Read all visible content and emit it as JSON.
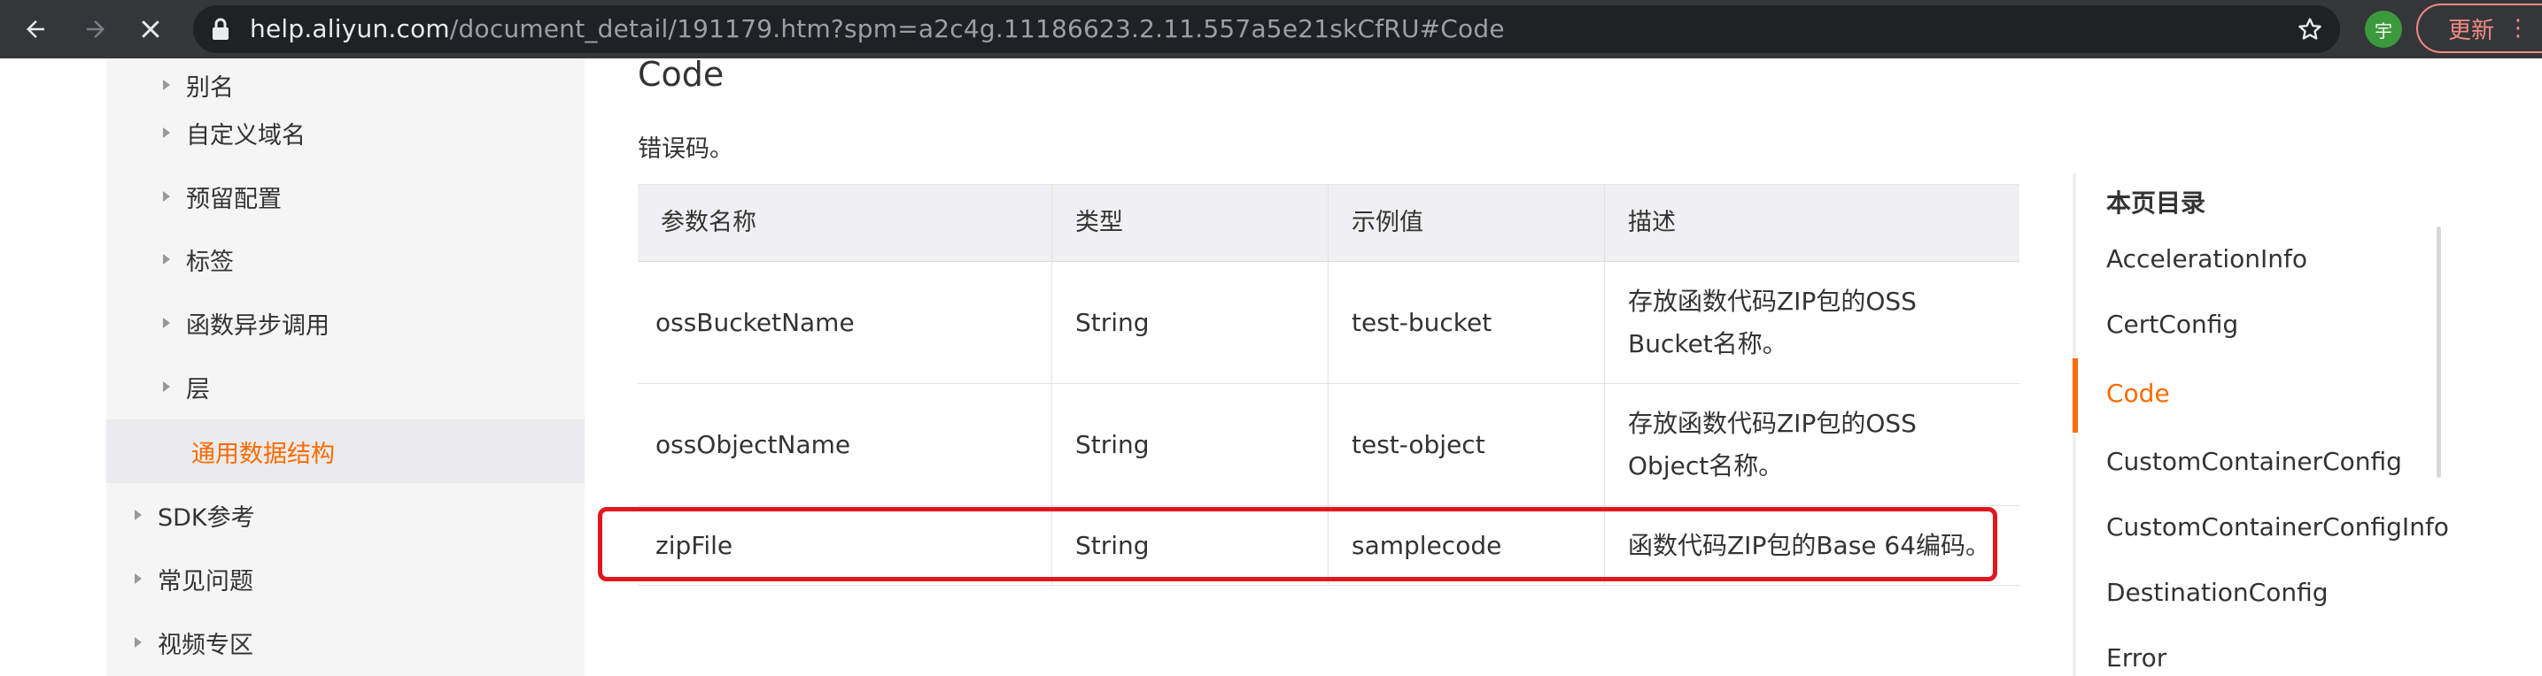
{
  "browser": {
    "url_host": "help.aliyun.com",
    "url_path": "/document_detail/191179.htm?spm=a2c4g.11186623.2.11.557a5e21skCfRU#Code",
    "profile_initial": "宇",
    "update_label": "更新"
  },
  "sidebar": {
    "items": [
      {
        "label": "别名"
      },
      {
        "label": "自定义域名"
      },
      {
        "label": "预留配置"
      },
      {
        "label": "标签"
      },
      {
        "label": "函数异步调用"
      },
      {
        "label": "层"
      },
      {
        "label": "通用数据结构"
      },
      {
        "label": "SDK参考"
      },
      {
        "label": "常见问题"
      },
      {
        "label": "视频专区"
      }
    ]
  },
  "main": {
    "heading": "Code",
    "description": "错误码。",
    "table": {
      "headers": [
        "参数名称",
        "类型",
        "示例值",
        "描述"
      ],
      "rows": [
        [
          "ossBucketName",
          "String",
          "test-bucket",
          "存放函数代码ZIP包的OSS Bucket名称。"
        ],
        [
          "ossObjectName",
          "String",
          "test-object",
          "存放函数代码ZIP包的OSS Object名称。"
        ],
        [
          "zipFile",
          "String",
          "samplecode",
          "函数代码ZIP包的Base 64编码。"
        ]
      ]
    }
  },
  "toc": {
    "title": "本页目录",
    "items": [
      {
        "label": "AccelerationInfo"
      },
      {
        "label": "CertConfig"
      },
      {
        "label": "Code"
      },
      {
        "label": "CustomContainerConfig"
      },
      {
        "label": "CustomContainerConfigInfo"
      },
      {
        "label": "DestinationConfig"
      },
      {
        "label": "Error"
      }
    ]
  },
  "colors": {
    "accent": "#ff6a00",
    "highlight_border": "#e0181e",
    "chrome_bg": "#35363a"
  }
}
